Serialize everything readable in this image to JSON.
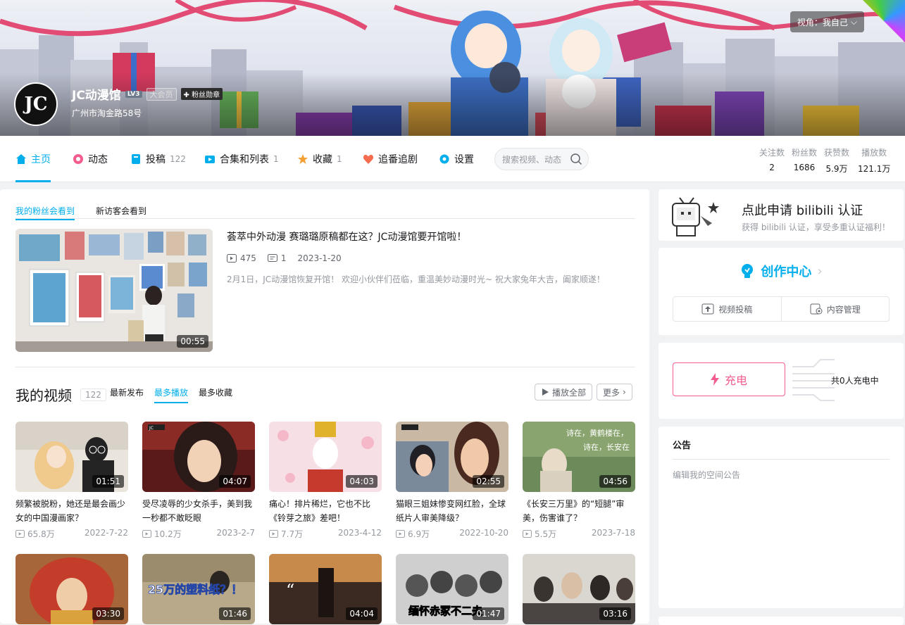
{
  "header": {
    "username": "JC动漫馆",
    "level": "LV3",
    "vip": "大会员",
    "medal": "粉丝勋章",
    "address": "广州市淘金路58号",
    "view_label": "视角：我自己",
    "avatar_text": "JC"
  },
  "nav": {
    "tabs": [
      {
        "label": "主页",
        "count": "",
        "icon": "home-icon",
        "color": "#00aeec"
      },
      {
        "label": "动态",
        "count": "",
        "icon": "dynamic-icon",
        "color": "#f25d8e"
      },
      {
        "label": "投稿",
        "count": "122",
        "icon": "upload-icon",
        "color": "#00aeec"
      },
      {
        "label": "合集和列表",
        "count": "1",
        "icon": "collection-icon",
        "color": "#00aeec"
      },
      {
        "label": "收藏",
        "count": "1",
        "icon": "star-icon",
        "color": "#f3a034"
      },
      {
        "label": "追番追剧",
        "count": "",
        "icon": "heart-icon",
        "color": "#f56c4f"
      },
      {
        "label": "设置",
        "count": "",
        "icon": "gear-icon",
        "color": "#00aeec"
      }
    ],
    "search_placeholder": "搜索视频、动态",
    "stats": [
      {
        "label": "关注数",
        "value": "2"
      },
      {
        "label": "粉丝数",
        "value": "1686"
      },
      {
        "label": "获赞数",
        "value": "5.9万"
      },
      {
        "label": "播放数",
        "value": "121.1万"
      }
    ]
  },
  "featured": {
    "tabs": [
      "我的粉丝会看到",
      "新访客会看到"
    ],
    "title": "荟萃中外动漫 赛璐璐原稿都在这？JC动漫馆要开馆啦！",
    "plays": "475",
    "comments": "1",
    "date": "2023-1-20",
    "desc": "2月1日，JC动漫馆恢复开馆！ 欢迎小伙伴们莅临，重温美妙动漫时光~ 祝大家兔年大吉，阖家顺遂！",
    "duration": "00:55"
  },
  "videos": {
    "title": "我的视频",
    "count": "122",
    "sorts": [
      "最新发布",
      "最多播放",
      "最多收藏"
    ],
    "play_all": "播放全部",
    "more": "更多",
    "items": [
      {
        "title": "频繁被脱粉，她还是最会画少女的中国漫画家？",
        "duration": "01:51",
        "plays": "65.8万",
        "date": "2022-7-22"
      },
      {
        "title": "受尽凌辱的少女杀手，美到我一秒都不敢眨眼",
        "duration": "04:07",
        "plays": "10.2万",
        "date": "2023-2-7"
      },
      {
        "title": "痛心！排片稀烂，它也不比《铃芽之旅》差吧！",
        "duration": "04:03",
        "plays": "7.7万",
        "date": "2023-4-12"
      },
      {
        "title": "猫眼三姐妹惨变网红脸，全球纸片人审美降级？",
        "duration": "02:55",
        "plays": "6.9万",
        "date": "2022-10-20"
      },
      {
        "title": "《长安三万里》的“短腿”审美，伤害谁了？",
        "duration": "04:56",
        "plays": "5.5万",
        "date": "2023-7-18"
      },
      {
        "title": "",
        "duration": "03:30",
        "plays": "",
        "date": ""
      },
      {
        "title": "",
        "duration": "01:46",
        "plays": "",
        "date": "",
        "caption": "25万的塑料纸？！"
      },
      {
        "title": "",
        "duration": "04:04",
        "plays": "",
        "date": ""
      },
      {
        "title": "",
        "duration": "01:47",
        "plays": "",
        "date": "",
        "caption": "缅怀赤冢不二夫"
      },
      {
        "title": "",
        "duration": "03:16",
        "plays": "",
        "date": ""
      }
    ],
    "thumb_text": {
      "v5_poem1": "诗在，黄鹤楼在，",
      "v5_poem2": "诗在，长安在"
    }
  },
  "sidebar": {
    "auth_title": "点此申请 bilibili 认证",
    "auth_sub": "获得 bilibili 认证，享受多重认证福利！",
    "creator_title": "创作中心",
    "creator_btn1": "视频投稿",
    "creator_btn2": "内容管理",
    "charge_btn": "充电",
    "charge_count": "共0人充电中",
    "notice_title": "公告",
    "notice_text": "编辑我的空间公告"
  },
  "colors": {
    "accent": "#00aeec",
    "pink": "#f25d8e"
  }
}
